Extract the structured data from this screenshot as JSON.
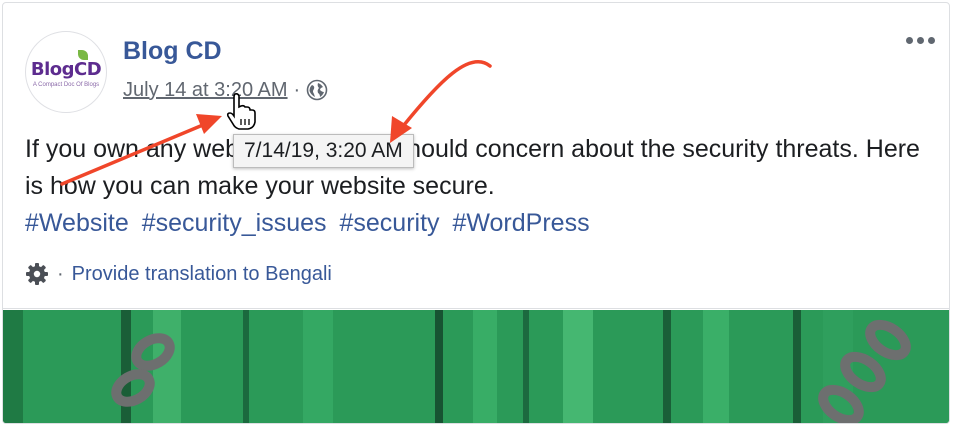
{
  "post": {
    "author": "Blog CD",
    "timestamp": "July 14 at 3:20 AM",
    "meta_separator": "·",
    "visibility_icon": "globe-icon",
    "text": "If you own any website, then you should concern about the security threats. Here is how you can make your website secure.",
    "hashtags": [
      "#Website",
      "#security_issues",
      "#security",
      "#WordPress"
    ],
    "translation_link": "Provide translation to Bengali",
    "translation_separator": "·"
  },
  "avatar": {
    "logo_text": "BlogCD",
    "logo_subtitle": "A Compact Doc Of Blogs"
  },
  "tooltip": {
    "text": "7/14/19, 3:20 AM"
  },
  "colors": {
    "link_blue": "#385898",
    "annotation_red": "#f0462a",
    "photo_green": "#2f9f5c"
  }
}
